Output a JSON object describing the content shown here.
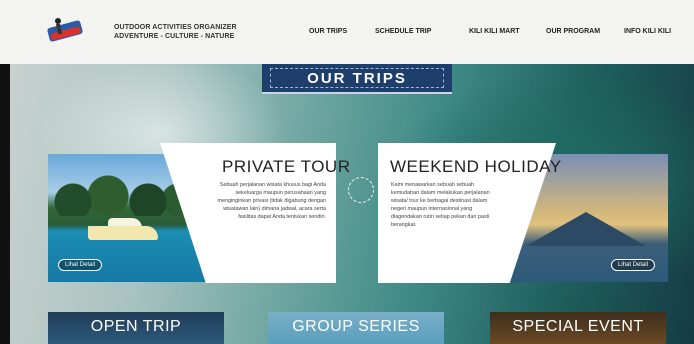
{
  "header": {
    "tagline_line1": "OUTDOOR ACTIVITIES ORGANIZER",
    "tagline_line2": "ADVENTURE - CULTURE - NATURE",
    "nav": [
      "OUR TRIPS",
      "SCHEDULE TRIP",
      "KILI KILI MART",
      "OUR PROGRAM",
      "INFO KILI KILI"
    ]
  },
  "section_title": "OUR TRIPS",
  "cards": [
    {
      "title": "PRIVATE TOUR",
      "description": "Sebuah perjalanan wisata khusus bagi Anda sekeluarga maupun perusahaan yang menginginkan privasi (tidak digabung dengan wisatawan lain) dimana jadwal, acara serta fasilitas dapat Anda tentukan sendiri.",
      "button": "Lihat Detail"
    },
    {
      "title": "WEEKEND HOLIDAY",
      "description": "Kami menawarkan sebuah sebuah kemudahan dalam melakukan perjalanan wisata/ tour ke berbagai destinasi dalam negeri maupun internasional yang diagendakan rutin setiap pekan dan pasti berangkat.",
      "button": "Lihat Detail"
    }
  ],
  "tiles": [
    "OPEN TRIP",
    "GROUP SERIES",
    "SPECIAL EVENT"
  ],
  "colors": {
    "banner": "#1e3f6b",
    "header_bg": "#f3f3f1"
  }
}
